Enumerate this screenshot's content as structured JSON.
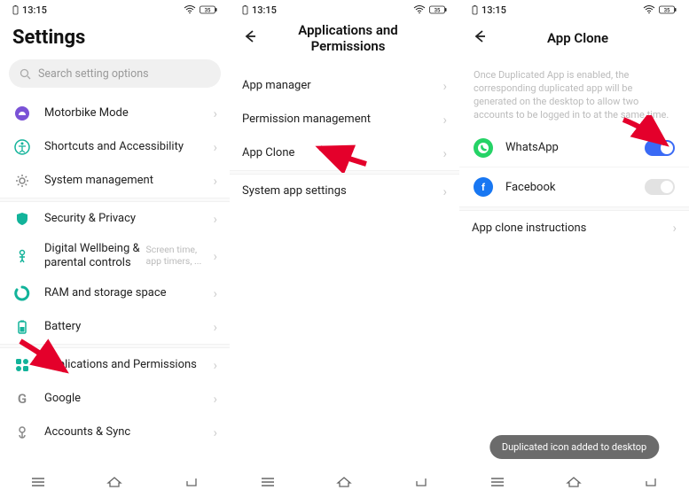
{
  "status": {
    "time": "13:15"
  },
  "phone1": {
    "title": "Settings",
    "search_placeholder": "Search setting options",
    "items": {
      "motorbike": "Motorbike Mode",
      "shortcuts": "Shortcuts and Accessibility",
      "system": "System management",
      "security": "Security & Privacy",
      "wellbeing": "Digital Wellbeing & parental controls",
      "wellbeing_sub": "Screen time, app timers, ...",
      "ram": "RAM and storage space",
      "battery": "Battery",
      "apps": "Applications and Permissions",
      "google": "Google",
      "accounts": "Accounts & Sync"
    }
  },
  "phone2": {
    "title": "Applications and Permissions",
    "items": {
      "app_manager": "App manager",
      "perm_mgmt": "Permission management",
      "app_clone": "App Clone",
      "sys_app": "System app settings"
    }
  },
  "phone3": {
    "title": "App Clone",
    "description": "Once Duplicated App is enabled, the corresponding duplicated app will be generated on the desktop to allow two accounts to be logged in to at the same time.",
    "apps": {
      "whatsapp": "WhatsApp",
      "facebook": "Facebook"
    },
    "instructions": "App clone instructions",
    "toast": "Duplicated icon added to desktop"
  }
}
